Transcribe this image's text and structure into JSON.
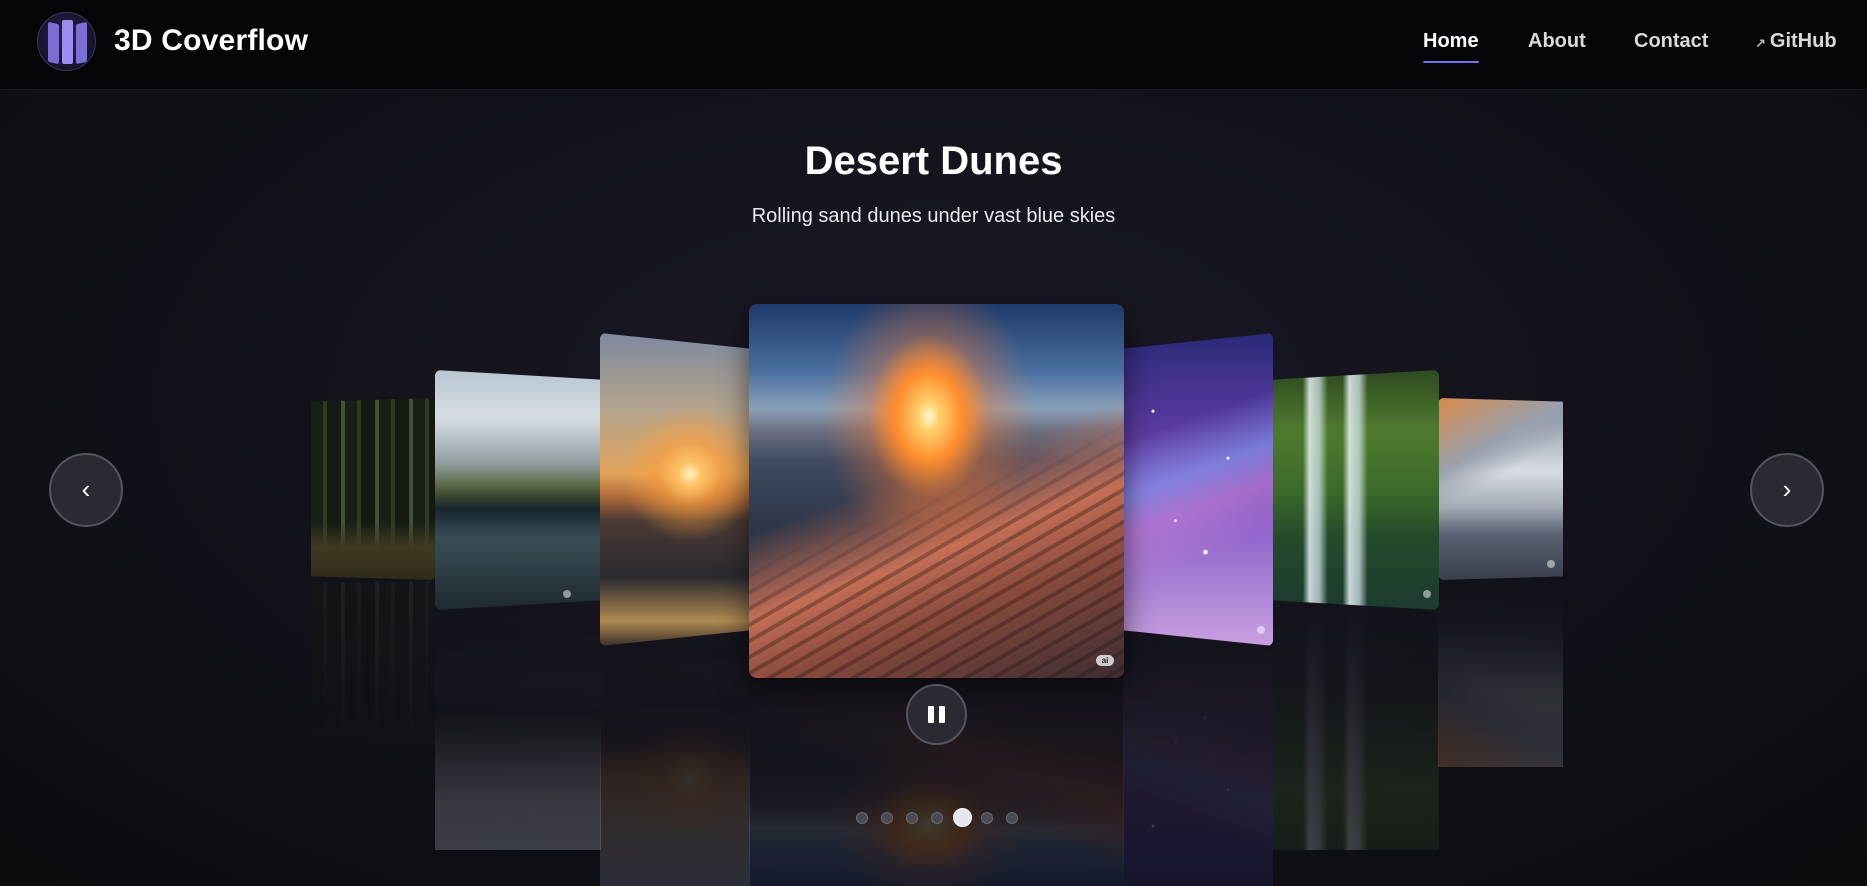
{
  "header": {
    "brand": "3D Coverflow",
    "nav": {
      "home": "Home",
      "about": "About",
      "contact": "Contact",
      "github": "GitHub"
    },
    "active_nav": "Home"
  },
  "slide": {
    "title": "Desert Dunes",
    "subtitle": "Rolling sand dunes under vast blue skies",
    "badge": "ai"
  },
  "controls": {
    "prev": "‹",
    "next": "›",
    "state": "playing"
  },
  "pagination": {
    "total": 7,
    "active_index": 4
  },
  "colors": {
    "accent": "#7a6ff0",
    "background": "#121119",
    "header_bg": "#050507"
  }
}
